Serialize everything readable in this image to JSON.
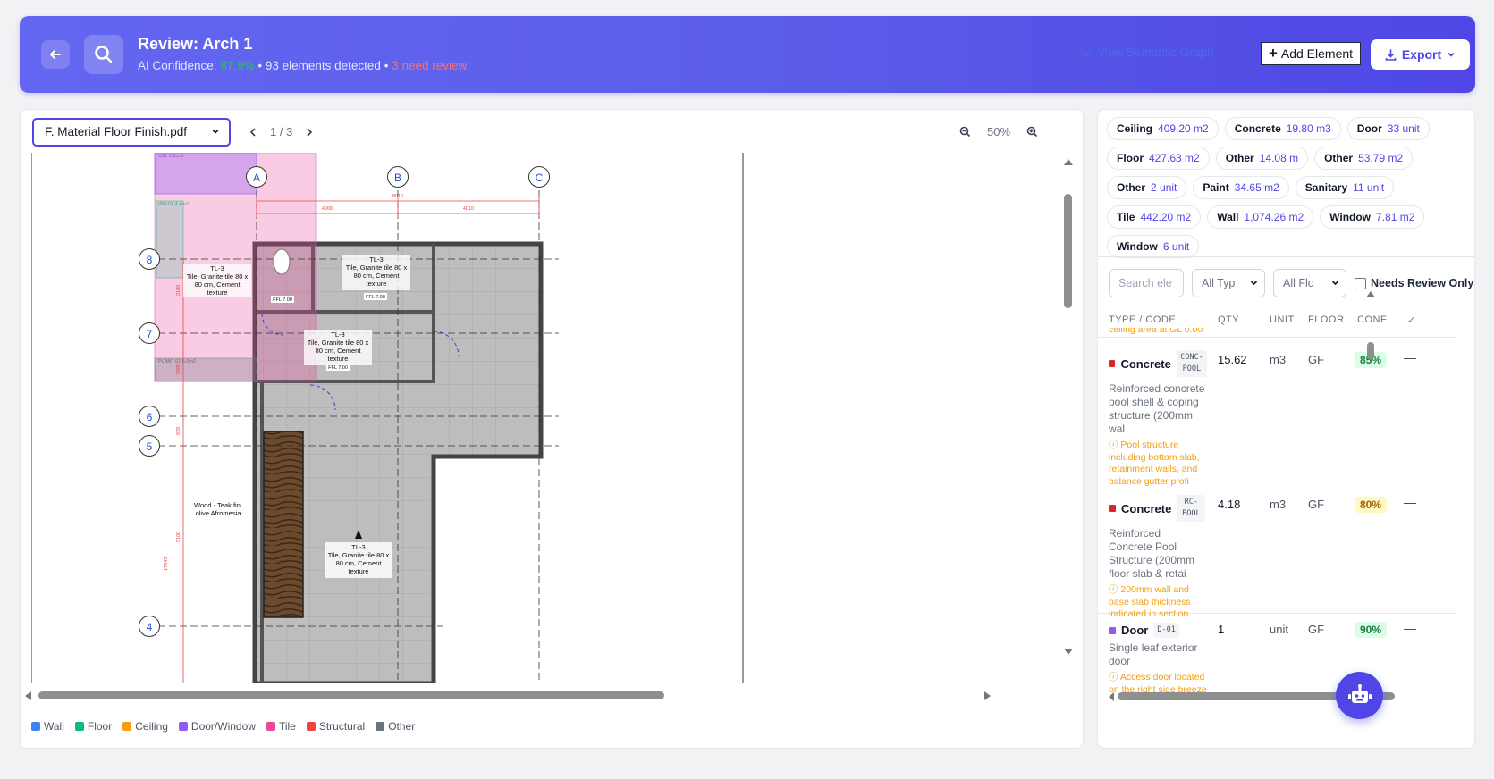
{
  "header": {
    "title": "Review: Arch 1",
    "subtitle_prefix": "AI Confidence:",
    "confidence": "87.9%",
    "elements_detected": "• 93 elements detected •",
    "need_review": "3 need review",
    "view_link": "View Semantic Graph",
    "add_button": "Add Element",
    "export_button": "Export"
  },
  "viewer": {
    "file": "F. Material Floor Finish.pdf",
    "page": "1 / 3",
    "zoom": "50%",
    "drawing": {
      "grid_cols": [
        "A",
        "B",
        "C"
      ],
      "grid_rows": [
        "8",
        "7",
        "6",
        "5",
        "4"
      ],
      "dim_total": "8010",
      "dim_1": "4000",
      "dim_2": "4010",
      "dim_v1": "2100",
      "dim_v2": "2085",
      "dim_v3": "828",
      "dim_v4": "5100",
      "dim_v5": "17243",
      "tag_ceiling": "C01 3.2unit",
      "tag_wd": "WD-01 4.4m2",
      "tag_plant": "PLANT 01 6.0m2",
      "ffl": "FFL 7.00",
      "label_tl3_code": "TL-3",
      "label_tl3_text": [
        "Tile, Granite tile 80 x",
        "80 cm, Cement",
        "texture"
      ],
      "label_wood": [
        "Wood - Teak fin.",
        "olive Afromesia"
      ]
    },
    "legend": [
      {
        "label": "Wall",
        "color": "#3b82f6"
      },
      {
        "label": "Floor",
        "color": "#10b981"
      },
      {
        "label": "Ceiling",
        "color": "#f59e0b"
      },
      {
        "label": "Door/Window",
        "color": "#8b5cf6"
      },
      {
        "label": "Tile",
        "color": "#ec4899"
      },
      {
        "label": "Structural",
        "color": "#ef4444"
      },
      {
        "label": "Other",
        "color": "#6b7280"
      }
    ]
  },
  "summary_chips": [
    {
      "type": "Ceiling",
      "value": "409.20 m2"
    },
    {
      "type": "Concrete",
      "value": "19.80 m3"
    },
    {
      "type": "Door",
      "value": "33 unit"
    },
    {
      "type": "Floor",
      "value": "427.63 m2"
    },
    {
      "type": "Other",
      "value": "14.08 m"
    },
    {
      "type": "Other",
      "value": "53.79 m2"
    },
    {
      "type": "Other",
      "value": "2 unit"
    },
    {
      "type": "Paint",
      "value": "34.65 m2"
    },
    {
      "type": "Sanitary",
      "value": "11 unit"
    },
    {
      "type": "Tile",
      "value": "442.20 m2"
    },
    {
      "type": "Wall",
      "value": "1,074.26 m2"
    },
    {
      "type": "Window",
      "value": "7.81 m2"
    },
    {
      "type": "Window",
      "value": "6 unit"
    }
  ],
  "filters": {
    "search_placeholder": "Search ele",
    "type_select": "All Typ",
    "floor_select": "All Flo",
    "needs_review": "Needs Review Only"
  },
  "table": {
    "headers": [
      "TYPE / CODE",
      "QTY",
      "UNIT",
      "FLOOR",
      "CONF",
      "✓"
    ],
    "cut_text": "ceiling area at GL 0.00",
    "rows": [
      {
        "type": "Concrete",
        "code": "CONC-POOL",
        "qty": "15.62",
        "unit": "m3",
        "floor": "GF",
        "conf": "85%",
        "desc": "Reinforced concrete pool shell & coping structure (200mm wal",
        "note": "Pool structure including bottom slab, retainment walls, and balance gutter profi",
        "action": "—"
      },
      {
        "type": "Concrete",
        "code": "RC-POOL",
        "qty": "4.18",
        "unit": "m3",
        "floor": "GF",
        "conf": "80%",
        "desc": "Reinforced Concrete Pool Structure (200mm floor slab & retai",
        "note": "200mm wall and base slab thickness indicated in section",
        "action": "—"
      },
      {
        "type": "Door",
        "code": "D-01",
        "qty": "1",
        "unit": "unit",
        "floor": "GF",
        "conf": "90%",
        "desc": "Single leaf exterior door",
        "note": "Access door located on the right side breeze block wall.",
        "action": "—"
      }
    ]
  },
  "colors": {
    "accent": "#4f46e5",
    "concrete_dot": "#dc2626",
    "door_dot": "#8b5cf6",
    "conf_green_bg": "#dcfce7",
    "conf_green_fg": "#15803d",
    "conf_yellow_bg": "#fef9c3",
    "conf_yellow_fg": "#a16207"
  }
}
